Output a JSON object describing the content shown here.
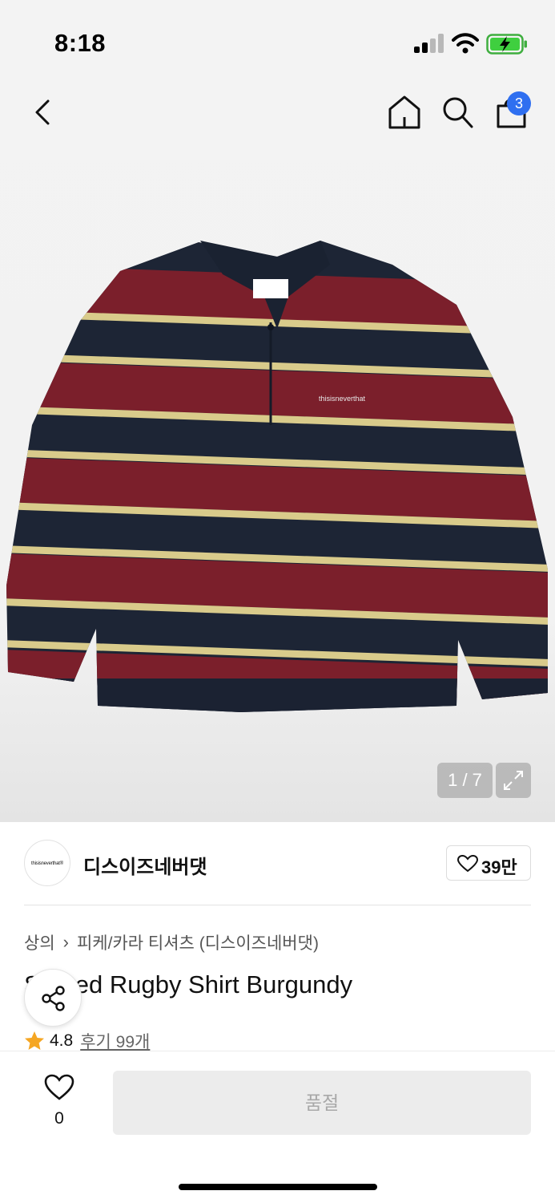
{
  "status_bar": {
    "time": "8:18",
    "signal_icon": "cellular-signal-icon",
    "wifi_icon": "wifi-icon",
    "battery_icon": "battery-charging-icon"
  },
  "header": {
    "back_icon": "chevron-left-icon",
    "home_icon": "home-icon",
    "search_icon": "search-icon",
    "cart_icon": "shopping-bag-icon",
    "cart_badge": "3"
  },
  "gallery": {
    "image_subject": "striped long-sleeve rugby polo shirt",
    "stripe_colors": [
      "#1c2433",
      "#7d1f2c",
      "#d8c98a"
    ],
    "pager": "1 / 7",
    "expand_icon": "expand-icon"
  },
  "brand": {
    "logo_text": "thisisneverthat®",
    "name": "디스이즈네버댓",
    "like_icon": "heart-outline-icon",
    "like_count": "39만"
  },
  "product": {
    "breadcrumb": [
      "상의",
      "피케/카라 티셔츠 (디스이즈네버댓)"
    ],
    "breadcrumb_separator": "›",
    "title": "Striped Rugby Shirt Burgundy",
    "rating": "4.8",
    "review_label": "후기 99개",
    "star_color": "#f5a623"
  },
  "share": {
    "icon": "share-icon"
  },
  "bottom_bar": {
    "wish_icon": "heart-outline-icon",
    "wish_count": "0",
    "buy_button_label": "품절"
  },
  "colors": {
    "badge": "#2f6ff0",
    "soldout_bg": "#ececec",
    "soldout_text": "#a8a8a8"
  }
}
